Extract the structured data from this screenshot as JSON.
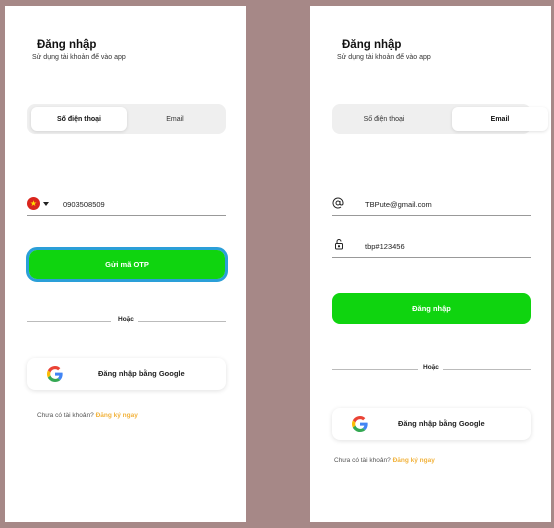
{
  "colors": {
    "background": "#a68887",
    "accent_green": "#0fd40f",
    "link_orange": "#f2b33d",
    "focus_blue": "#2a9fd8"
  },
  "left": {
    "title": "Đăng nhập",
    "subtitle": "Sử dụng tài khoản để vào app",
    "tabs": [
      {
        "label": "Số điện thoại",
        "active": true
      },
      {
        "label": "Email",
        "active": false
      }
    ],
    "phone": {
      "flag_icon": "vietnam-flag-icon",
      "value": "0903508509"
    },
    "send_otp_label": "Gửi mã OTP",
    "or_label": "Hoặc",
    "google_label": "Đăng nhập bằng Google",
    "signup_prompt": "Chưa có tài khoản?",
    "signup_link": "Đăng ký ngay"
  },
  "right": {
    "title": "Đăng nhập",
    "subtitle": "Sử dụng tài khoản để vào app",
    "tabs": [
      {
        "label": "Số điện thoại",
        "active": false
      },
      {
        "label": "Email",
        "active": true
      }
    ],
    "email": {
      "icon": "at-sign-icon",
      "value": "TBPute@gmail.com"
    },
    "password": {
      "icon": "lock-icon",
      "value": "tbp#123456"
    },
    "login_label": "Đăng nhập",
    "or_label": "Hoặc",
    "google_label": "Đăng nhập bằng Google",
    "signup_prompt": "Chưa có tài khoản?",
    "signup_link": "Đăng ký ngay"
  }
}
